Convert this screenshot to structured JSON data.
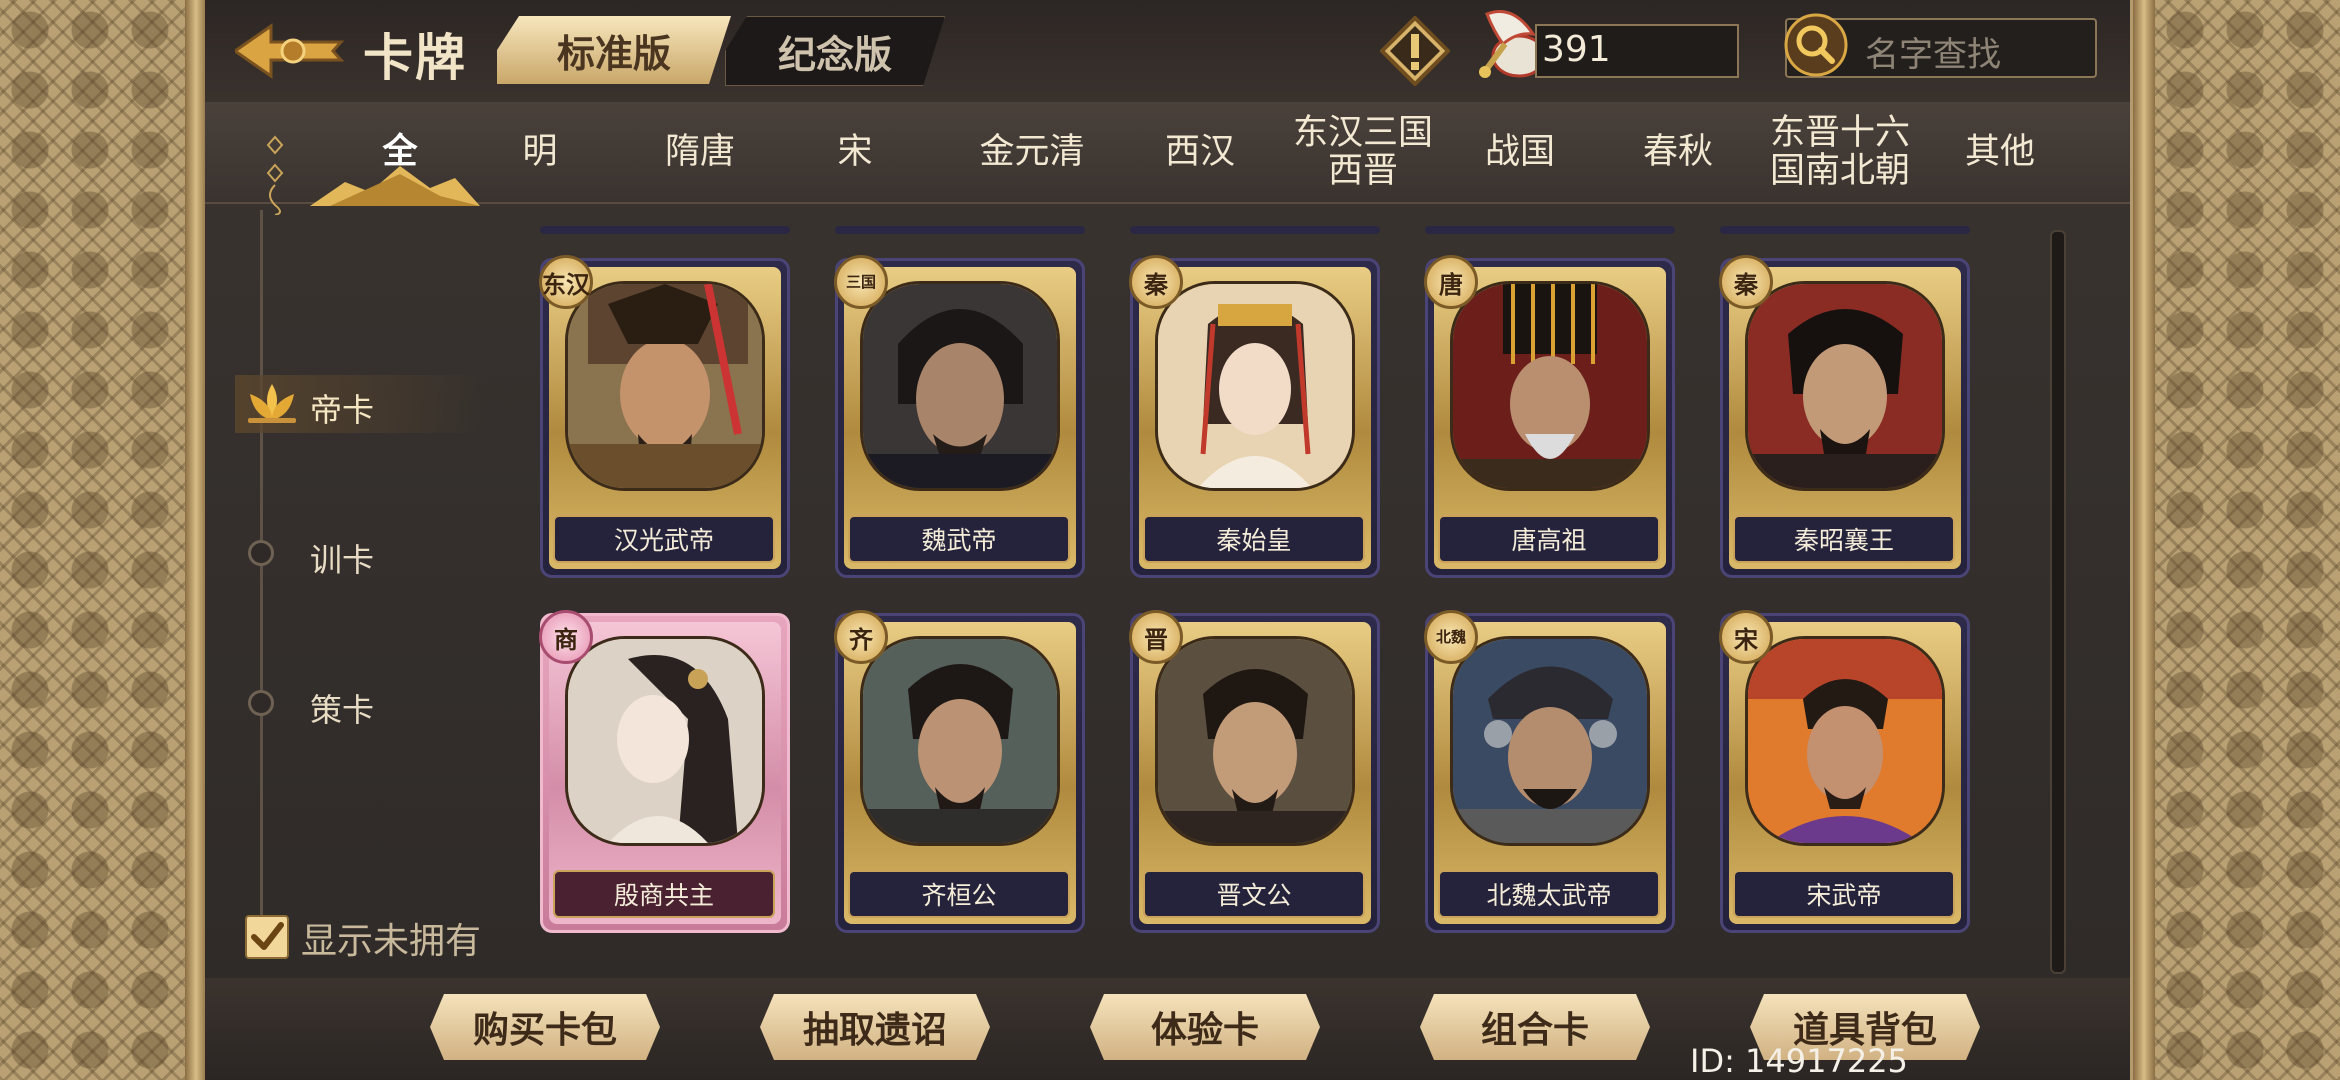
{
  "header": {
    "title": "卡牌",
    "edition_tabs": [
      {
        "label": "标准版",
        "active": true
      },
      {
        "label": "纪念版",
        "active": false
      }
    ],
    "currency_value": "391",
    "search_placeholder": "名字查找"
  },
  "era_tabs": [
    {
      "label": "全",
      "active": true
    },
    {
      "label": "明"
    },
    {
      "label": "隋唐"
    },
    {
      "label": "宋"
    },
    {
      "label": "金元清"
    },
    {
      "label": "西汉"
    },
    {
      "label": "东汉三国西晋",
      "line1": "东汉三国",
      "line2": "西晋"
    },
    {
      "label": "战国"
    },
    {
      "label": "春秋"
    },
    {
      "label": "东晋十六国南北朝",
      "line1": "东晋十六",
      "line2": "国南北朝"
    },
    {
      "label": "其他"
    }
  ],
  "card_categories": [
    {
      "label": "帝卡",
      "active": true
    },
    {
      "label": "训卡"
    },
    {
      "label": "策卡"
    }
  ],
  "show_unowned_label": "显示未拥有",
  "show_unowned_checked": true,
  "cards": [
    {
      "name": "汉光武帝",
      "era_badge": "东汉",
      "rarity": "gold"
    },
    {
      "name": "魏武帝",
      "era_badge": "三国",
      "rarity": "gold"
    },
    {
      "name": "秦始皇",
      "era_badge": "秦",
      "rarity": "gold"
    },
    {
      "name": "唐高祖",
      "era_badge": "唐",
      "rarity": "gold"
    },
    {
      "name": "秦昭襄王",
      "era_badge": "秦",
      "rarity": "gold"
    },
    {
      "name": "殷商共主",
      "era_badge": "商",
      "rarity": "pink"
    },
    {
      "name": "齐桓公",
      "era_badge": "齐",
      "rarity": "gold"
    },
    {
      "name": "晋文公",
      "era_badge": "晋",
      "rarity": "gold"
    },
    {
      "name": "北魏太武帝",
      "era_badge": "北魏",
      "rarity": "gold"
    },
    {
      "name": "宋武帝",
      "era_badge": "宋",
      "rarity": "gold"
    }
  ],
  "bottom_buttons": [
    {
      "label": "购买卡包"
    },
    {
      "label": "抽取遗诏"
    },
    {
      "label": "体验卡"
    },
    {
      "label": "组合卡"
    },
    {
      "label": "道具背包"
    }
  ],
  "player_id": "ID: 14917225",
  "colors": {
    "gold": "#d9b967",
    "pink": "#e7a6be",
    "frame": "#35302d"
  }
}
